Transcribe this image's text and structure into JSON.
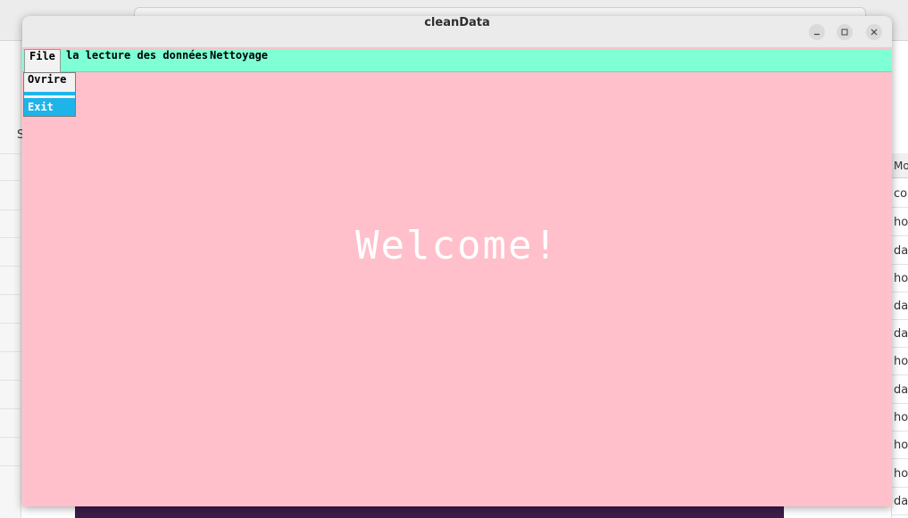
{
  "background": {
    "left_letter": "S",
    "right_header": "Mo",
    "right_cells": [
      "cond",
      "hou",
      "da",
      "hou",
      "da",
      "da",
      "hou",
      "da",
      "hou",
      "hou",
      "hou",
      "da"
    ]
  },
  "window": {
    "title": "cleanData",
    "controls": {
      "minimize_icon": "minimize-icon",
      "maximize_icon": "maximize-icon",
      "close_icon": "close-icon"
    }
  },
  "menubar": {
    "items": [
      {
        "label": "File"
      },
      {
        "label": "la lecture des données"
      },
      {
        "label": "Nettoyage"
      }
    ]
  },
  "file_menu": {
    "items": [
      {
        "label": "Ovrire"
      },
      {
        "label": "Exit"
      }
    ]
  },
  "content": {
    "welcome_text": "Welcome!"
  },
  "colors": {
    "menubar_bg": "#7fffd4",
    "content_bg": "#ffc0cb",
    "menu_highlight": "#1eb4ea",
    "welcome_text": "#ffffff"
  }
}
